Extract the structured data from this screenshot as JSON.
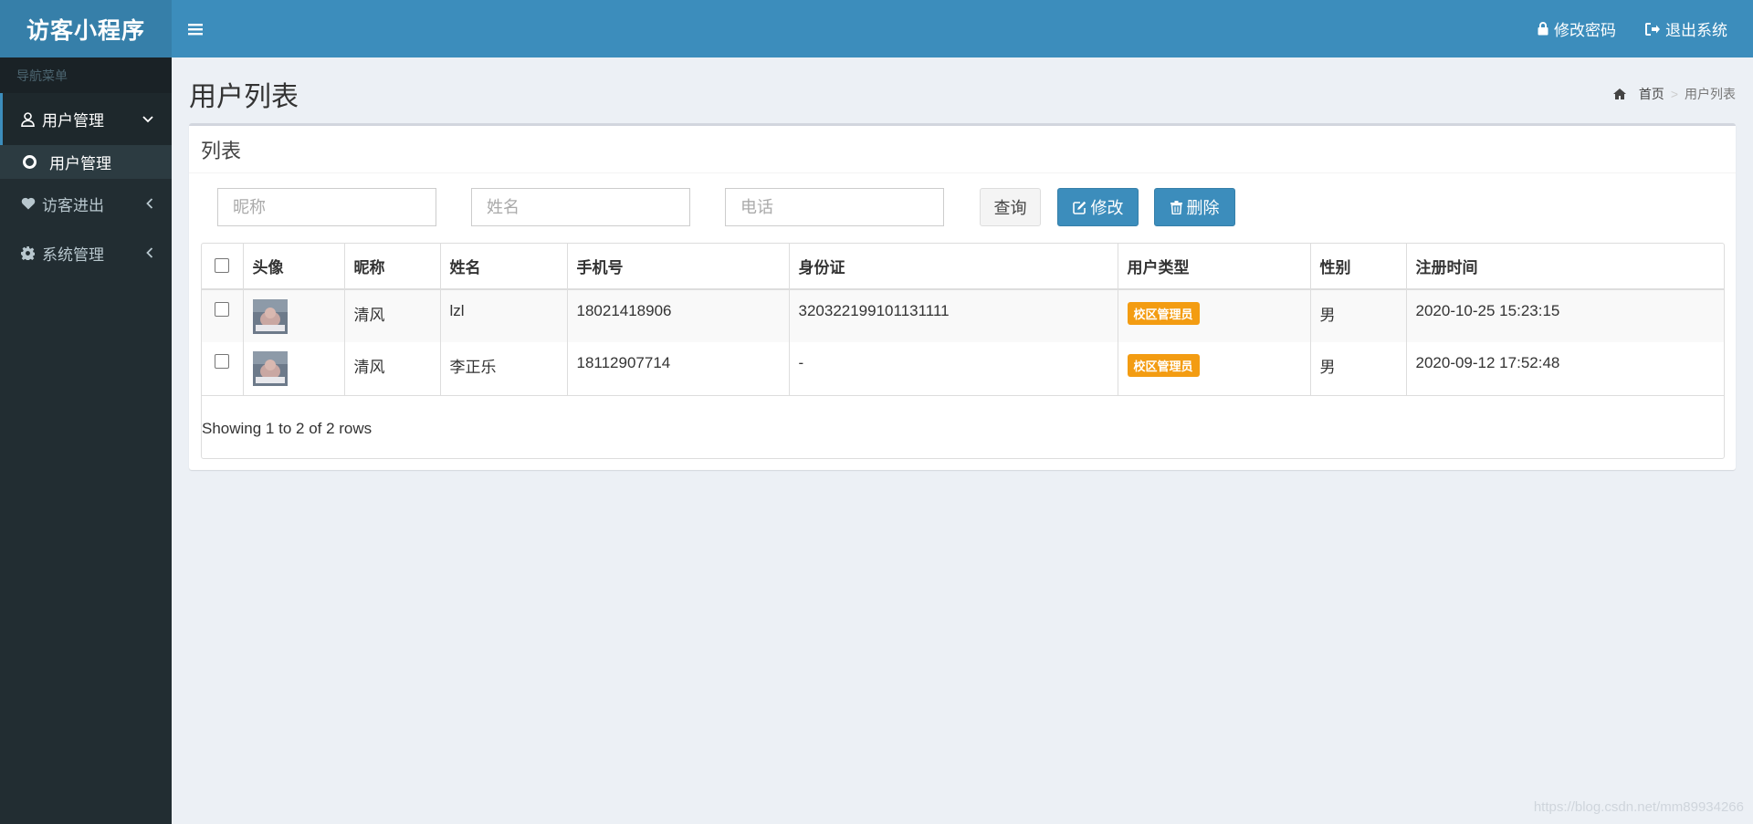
{
  "app": {
    "logo": "访客小程序"
  },
  "header": {
    "change_password": "修改密码",
    "logout": "退出系统"
  },
  "sidebar": {
    "header": "导航菜单",
    "items": [
      {
        "label": "用户管理",
        "icon": "user-icon",
        "expanded": true
      },
      {
        "label": "访客进出",
        "icon": "heart-icon",
        "expanded": false
      },
      {
        "label": "系统管理",
        "icon": "gear-icon",
        "expanded": false
      }
    ],
    "sub_items": [
      {
        "label": "用户管理"
      }
    ]
  },
  "page": {
    "title": "用户列表",
    "breadcrumb": {
      "home": "首页",
      "current": "用户列表"
    }
  },
  "box": {
    "title": "列表",
    "filters": {
      "nickname_placeholder": "昵称",
      "name_placeholder": "姓名",
      "phone_placeholder": "电话"
    },
    "buttons": {
      "query": "查询",
      "edit": "修改",
      "delete": "删除"
    }
  },
  "table": {
    "columns": [
      "头像",
      "昵称",
      "姓名",
      "手机号",
      "身份证",
      "用户类型",
      "性别",
      "注册时间"
    ],
    "rows": [
      {
        "nickname": "清风",
        "name": "lzl",
        "phone": "18021418906",
        "id_card": "320322199101131111",
        "type": "校区管理员",
        "gender": "男",
        "registered": "2020-10-25 15:23:15"
      },
      {
        "nickname": "清风",
        "name": "李正乐",
        "phone": "18112907714",
        "id_card": "-",
        "type": "校区管理员",
        "gender": "男",
        "registered": "2020-09-12 17:52:48"
      }
    ],
    "footer": "Showing 1 to 2 of 2 rows"
  },
  "watermark": "https://blog.csdn.net/mm89934266",
  "colors": {
    "primary": "#3c8dbc",
    "sidebar": "#222d32",
    "badge": "#f39c12"
  }
}
